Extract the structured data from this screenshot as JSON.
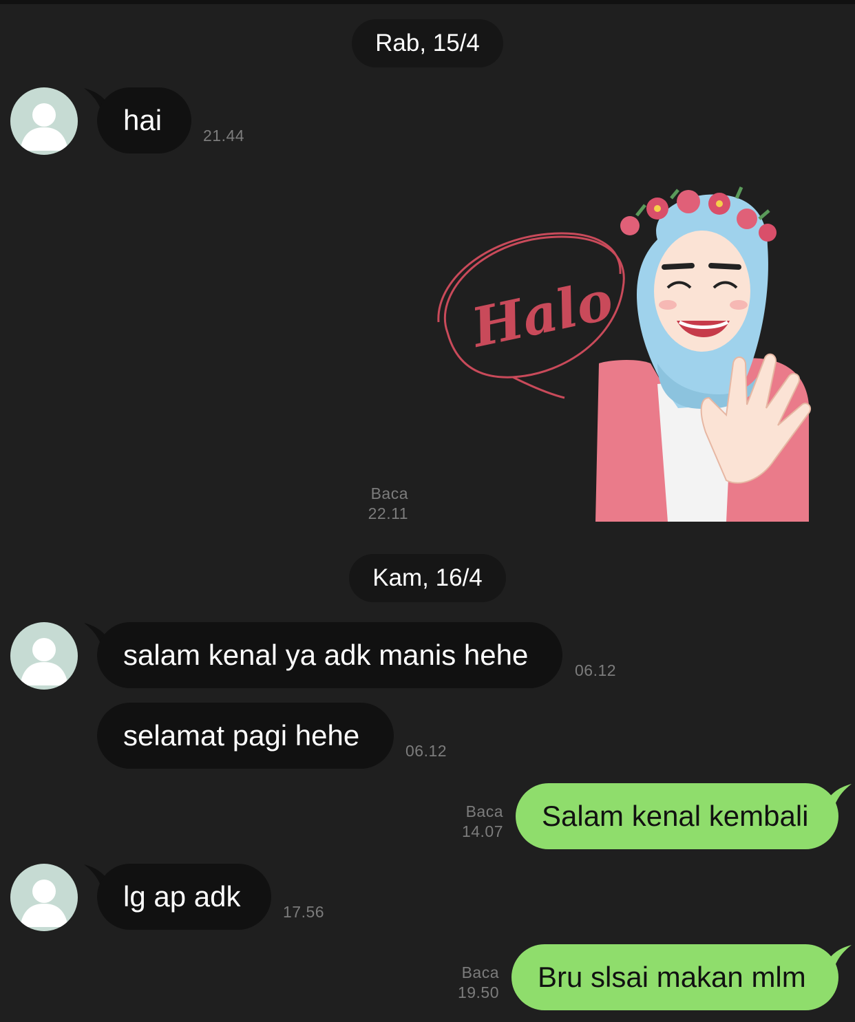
{
  "dates": [
    "Rab, 15/4",
    "Kam, 16/4"
  ],
  "messages": [
    {
      "dir": "in",
      "text": "hai",
      "time": "21.44"
    },
    {
      "dir": "out",
      "sticker": "halo-hijab-girl-sticker",
      "status": "Baca",
      "time": "22.11",
      "sticker_text": "Halo"
    },
    {
      "dir": "in",
      "text": "salam kenal ya adk manis hehe",
      "time": "06.12"
    },
    {
      "dir": "in",
      "text": "selamat pagi hehe",
      "time": "06.12"
    },
    {
      "dir": "out",
      "text": "Salam kenal kembali",
      "status": "Baca",
      "time": "14.07"
    },
    {
      "dir": "in",
      "text": "lg ap adk",
      "time": "17.56"
    },
    {
      "dir": "out",
      "text": "Bru slsai makan mlm",
      "status": "Baca",
      "time": "19.50"
    }
  ],
  "colors": {
    "background": "#1f1f1f",
    "incoming_bubble": "#111111",
    "outgoing_bubble": "#8fdd6c",
    "avatar": "#c6dbd3"
  },
  "icons": {
    "avatar": "default-user-avatar-icon"
  }
}
